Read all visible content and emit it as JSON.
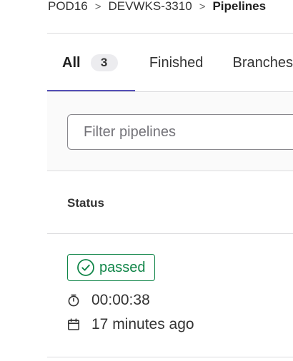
{
  "breadcrumb": {
    "items": [
      "POD16",
      "DEVWKS-3310",
      "Pipelines"
    ],
    "separator": ">"
  },
  "tabs": [
    {
      "label": "All",
      "count": "3",
      "active": true
    },
    {
      "label": "Finished"
    },
    {
      "label": "Branches"
    }
  ],
  "filter": {
    "placeholder": "Filter pipelines",
    "value": ""
  },
  "table": {
    "columns": [
      "Status"
    ],
    "rows": [
      {
        "status": "passed",
        "duration": "00:00:38",
        "finished": "17 minutes ago"
      }
    ]
  },
  "colors": {
    "accent": "#5450b6",
    "success": "#108548",
    "border": "#dcdcde"
  },
  "icons": {
    "status": "check-circle-icon",
    "duration": "timer-icon",
    "finished": "calendar-icon",
    "separator": "chevron-right-icon"
  }
}
